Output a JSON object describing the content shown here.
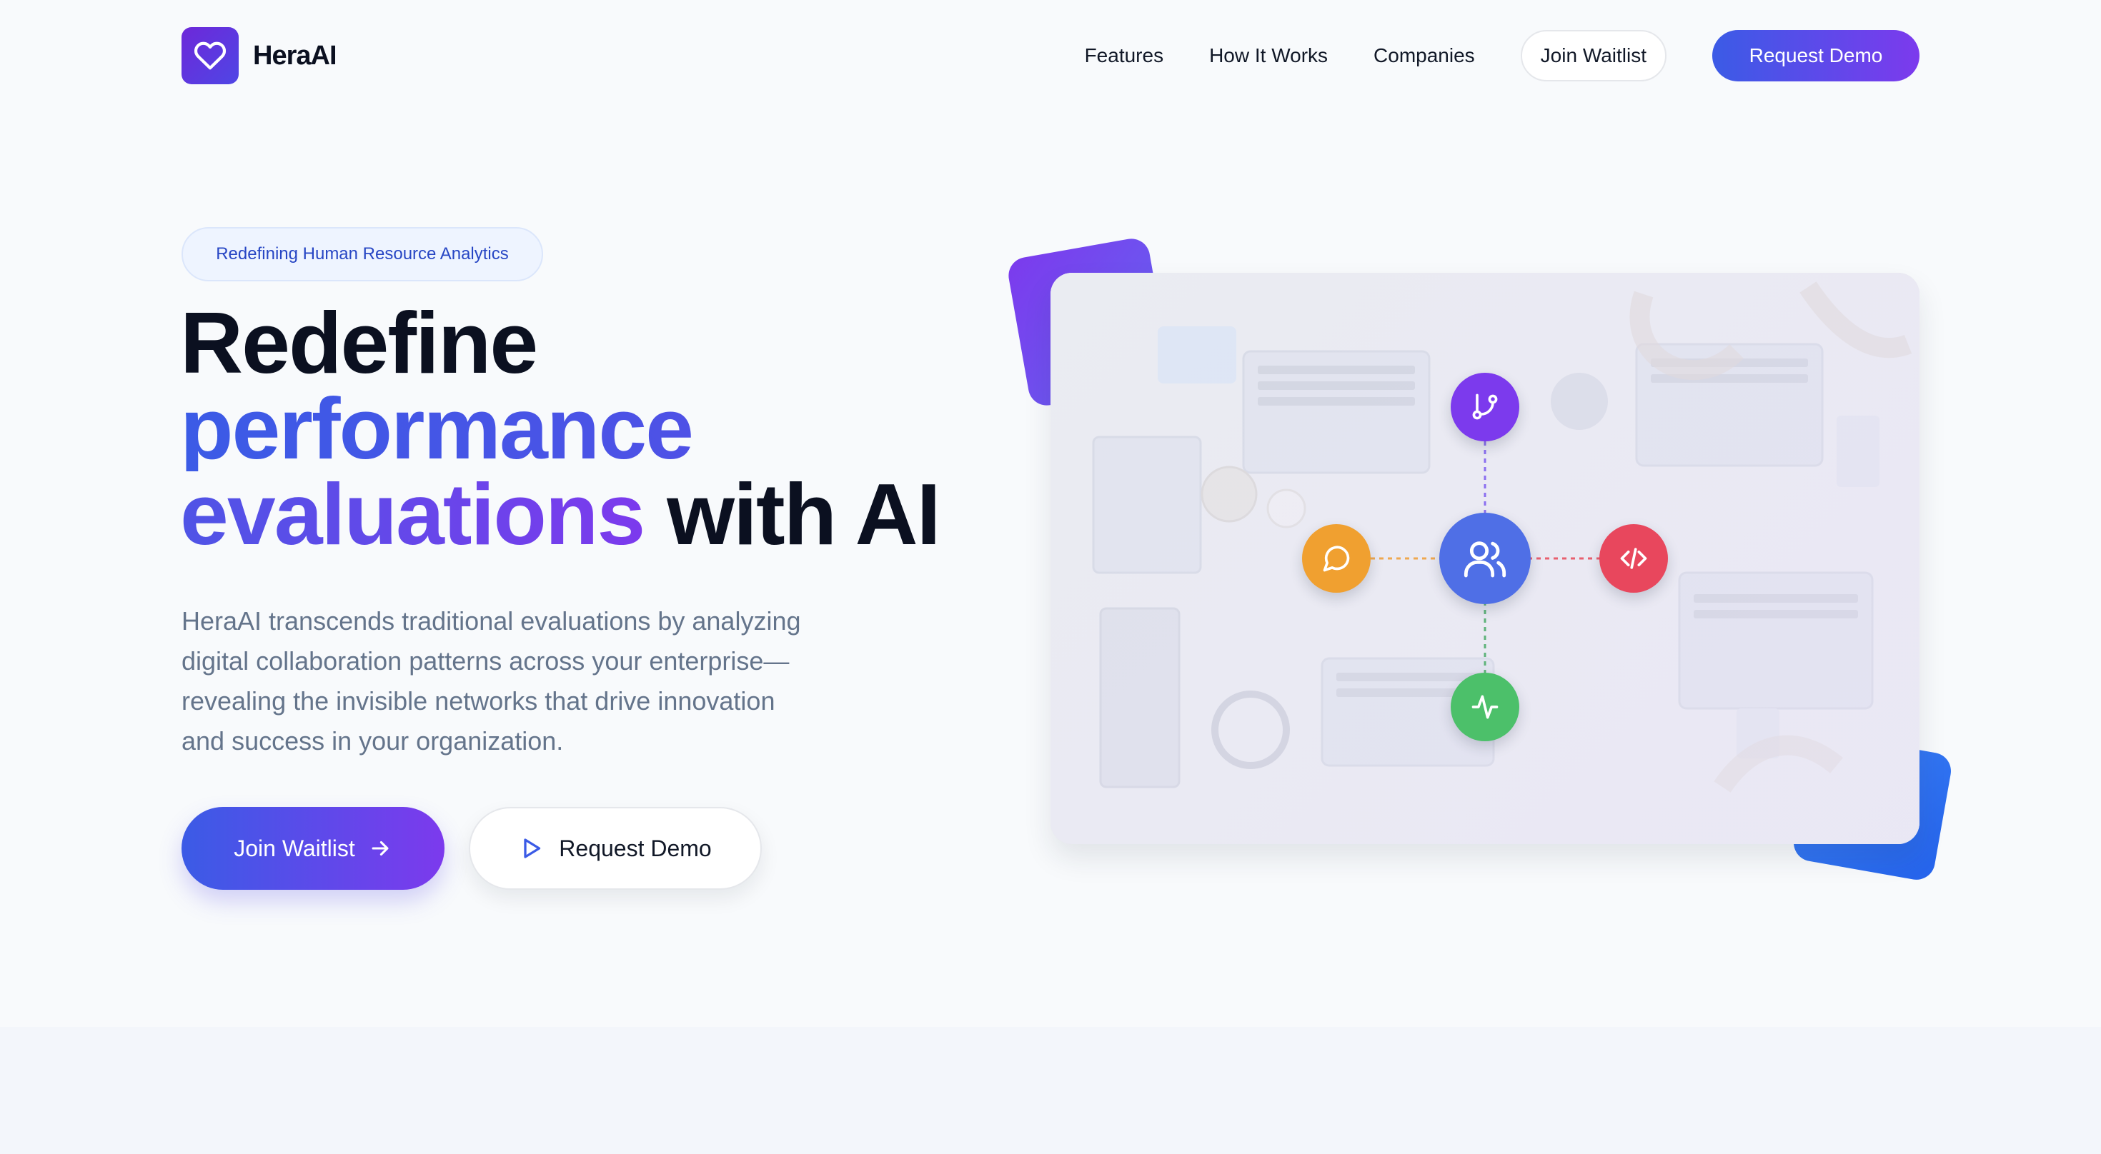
{
  "brand": {
    "name": "HeraAI"
  },
  "nav": {
    "links": [
      "Features",
      "How It Works",
      "Companies"
    ],
    "join_label": "Join Waitlist",
    "demo_label": "Request Demo"
  },
  "hero": {
    "badge": "Redefining Human Resource Analytics",
    "headline_1": "Redefine",
    "headline_2": "performance",
    "headline_3a": "evaluations",
    "headline_3b": "with AI",
    "description": "HeraAI transcends traditional evaluations by analyzing digital collaboration patterns across your enterprise—revealing the invisible networks that drive innovation and success in your organization.",
    "cta_primary": "Join Waitlist",
    "cta_secondary": "Request Demo"
  },
  "network": {
    "center_icon": "users-icon",
    "top_icon": "git-branch-icon",
    "left_icon": "message-circle-icon",
    "right_icon": "code-icon",
    "bottom_icon": "activity-icon"
  },
  "colors": {
    "accent_blue": "#3b5be6",
    "accent_purple": "#7c3aed",
    "node_center": "#4f6fe6",
    "node_top": "#7c3aed",
    "node_left": "#f0a030",
    "node_right": "#e8475d",
    "node_bottom": "#4cc06a"
  }
}
